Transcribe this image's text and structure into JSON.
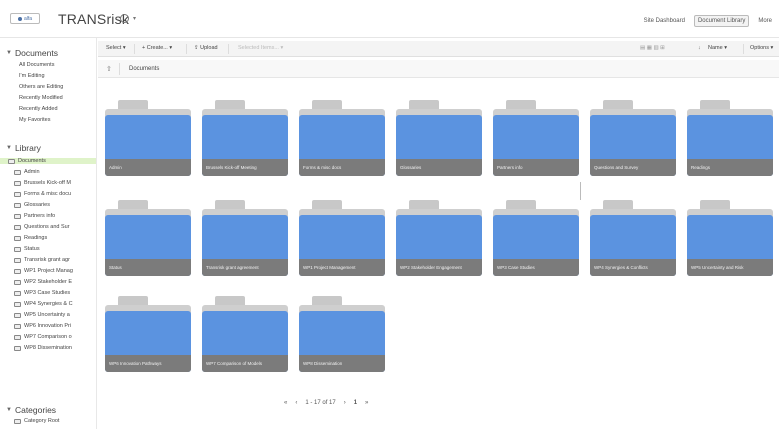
{
  "header": {
    "title": "TRANSrisk",
    "logo_text": "alfa",
    "links": [
      {
        "label": "Site Dashboard",
        "active": false
      },
      {
        "label": "Document Library",
        "active": true
      },
      {
        "label": "More",
        "active": false
      }
    ]
  },
  "sidebar": {
    "documents_heading": "Documents",
    "documents_items": [
      "All Documents",
      "I'm Editing",
      "Others are Editing",
      "Recently Modified",
      "Recently Added",
      "My Favorites"
    ],
    "library_heading": "Library",
    "library_root": "Documents",
    "library_items": [
      "Admin",
      "Brussels Kick-off M",
      "Forms & misc docu",
      "Glossaries",
      "Partners info",
      "Questions and Sur",
      "Readings",
      "Status",
      "Transrisk grant agr",
      "WP1 Project Manag",
      "WP2 Stakeholder E",
      "WP3 Case Studies",
      "WP4 Synergies & C",
      "WP5 Uncertainty a",
      "WP6 Innovation Pri",
      "WP7 Comparison o",
      "WP8 Dissemination"
    ],
    "categories_heading": "Categories",
    "categories_items": [
      "Category Root"
    ]
  },
  "toolbar": {
    "select_label": "Select ▾",
    "create_label": "+ Create... ▾",
    "upload_label": "⇪ Upload",
    "selected_items_label": "Selected Items... ▾",
    "sort_label": "Name ▾",
    "options_label": "Options ▾"
  },
  "breadcrumb": {
    "root": "Documents"
  },
  "folders": [
    "Admin",
    "Brussels Kick-off Meeting",
    "Forms & misc docs",
    "Glossaries",
    "Partners info",
    "Questions and Survey",
    "Readings",
    "Status",
    "Transrisk grant agreement",
    "WP1 Project Management",
    "WP2 Stakeholder Engagement",
    "WP3 Case Studies",
    "WP4 Synergies & Conflicts",
    "WP5 Uncertainty and Risk",
    "WP6 Innovation Pathways",
    "WP7 Comparison of Models",
    "WP8 Dissemination"
  ],
  "pager": {
    "first": "«",
    "prev": "‹",
    "range": "1 - 17 of 17",
    "next": "›",
    "last": "»",
    "page": "1"
  }
}
